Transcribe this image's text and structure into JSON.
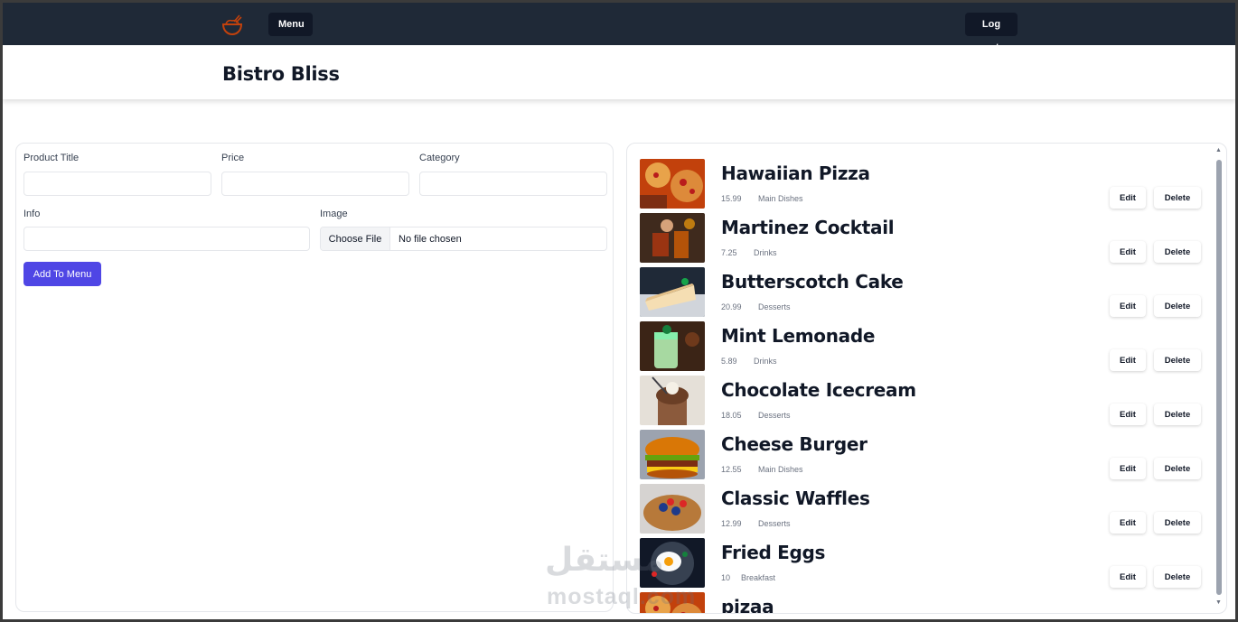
{
  "nav": {
    "logo_icon": "bowl-icon",
    "menu_label": "Menu",
    "logout_label": "Log out",
    "accent": "#c2410c"
  },
  "brand": {
    "title": "Bistro Bliss"
  },
  "form": {
    "product_title_label": "Product Title",
    "price_label": "Price",
    "category_label": "Category",
    "info_label": "Info",
    "image_label": "Image",
    "choose_file_label": "Choose File",
    "no_file_text": "No file chosen",
    "product_title_value": "",
    "price_value": "",
    "category_value": "",
    "info_value": "",
    "submit_label": "Add To Menu",
    "submit_color": "#4f46e5"
  },
  "menu_items": [
    {
      "title": "Hawaiian Pizza",
      "price": "15.99",
      "category": "Main Dishes",
      "edit": "Edit",
      "delete": "Delete",
      "image": "pizza"
    },
    {
      "title": "Martinez Cocktail",
      "price": "7.25",
      "category": "Drinks",
      "edit": "Edit",
      "delete": "Delete",
      "image": "cocktail"
    },
    {
      "title": "Butterscotch Cake",
      "price": "20.99",
      "category": "Desserts",
      "edit": "Edit",
      "delete": "Delete",
      "image": "cake"
    },
    {
      "title": "Mint Lemonade",
      "price": "5.89",
      "category": "Drinks",
      "edit": "Edit",
      "delete": "Delete",
      "image": "lemonade"
    },
    {
      "title": "Chocolate Icecream",
      "price": "18.05",
      "category": "Desserts",
      "edit": "Edit",
      "delete": "Delete",
      "image": "icecream"
    },
    {
      "title": "Cheese Burger",
      "price": "12.55",
      "category": "Main Dishes",
      "edit": "Edit",
      "delete": "Delete",
      "image": "burger"
    },
    {
      "title": "Classic Waffles",
      "price": "12.99",
      "category": "Desserts",
      "edit": "Edit",
      "delete": "Delete",
      "image": "waffles"
    },
    {
      "title": "Fried Eggs",
      "price": "10",
      "category": "Breakfast",
      "edit": "Edit",
      "delete": "Delete",
      "image": "eggs"
    },
    {
      "title": "pizaa",
      "price": "",
      "category": "",
      "edit": "",
      "delete": "",
      "image": "pizza"
    }
  ],
  "watermark": {
    "arabic": "مستقل",
    "latin": "mostaql.com"
  }
}
